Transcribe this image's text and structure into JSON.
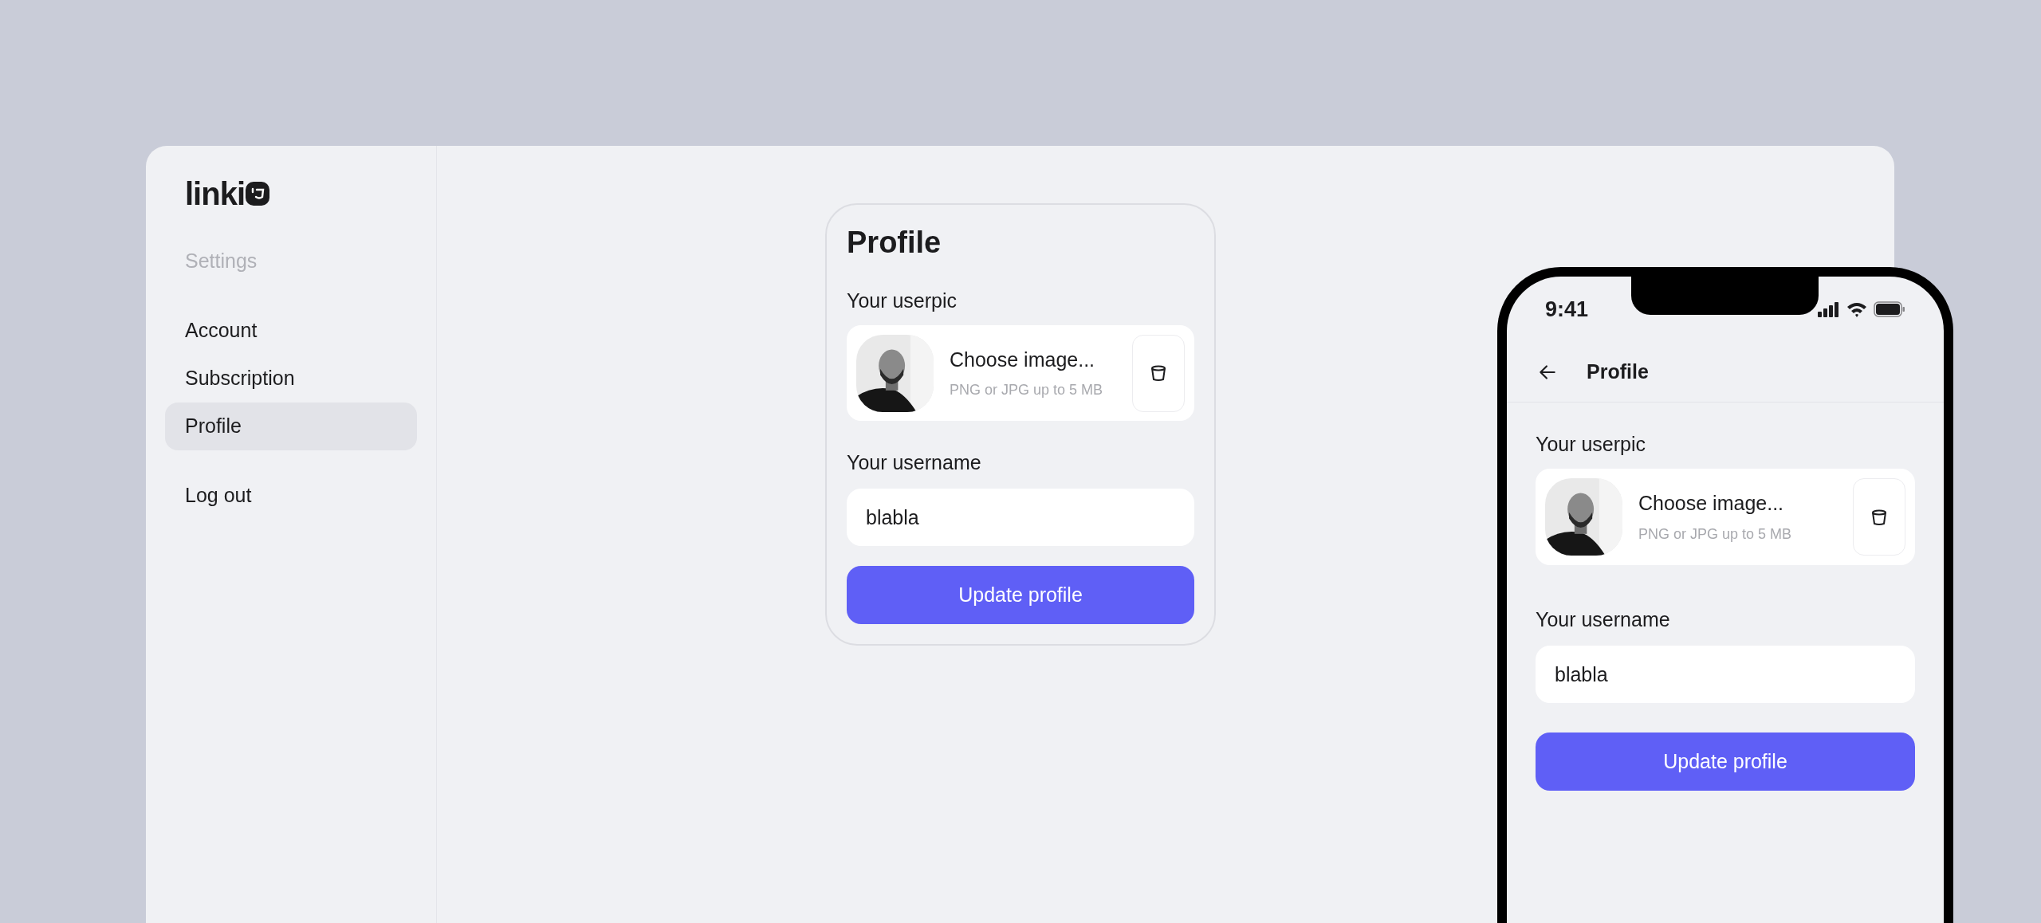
{
  "logo": {
    "text": "linki"
  },
  "sidebar": {
    "heading": "Settings",
    "items": [
      {
        "label": "Account",
        "selected": false
      },
      {
        "label": "Subscription",
        "selected": false
      },
      {
        "label": "Profile",
        "selected": true
      }
    ],
    "logout": "Log out"
  },
  "profile_card": {
    "title": "Profile",
    "userpic_label": "Your userpic",
    "upload_title": "Choose image...",
    "upload_hint": "PNG or JPG up to 5 MB",
    "username_label": "Your username",
    "username_value": "blabla",
    "submit": "Update profile"
  },
  "phone": {
    "time": "9:41",
    "header_title": "Profile",
    "userpic_label": "Your userpic",
    "upload_title": "Choose image...",
    "upload_hint": "PNG or JPG up to 5 MB",
    "username_label": "Your username",
    "username_value": "blabla",
    "submit": "Update profile"
  }
}
